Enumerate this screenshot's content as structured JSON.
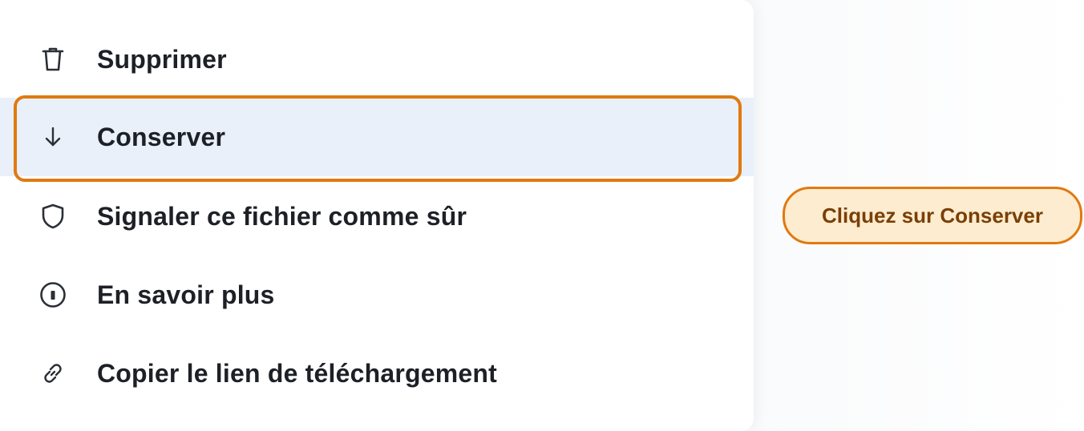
{
  "menu": {
    "items": [
      {
        "label": "Supprimer",
        "icon": "trash-icon"
      },
      {
        "label": "Conserver",
        "icon": "arrow-down-icon"
      },
      {
        "label": "Signaler ce fichier comme sûr",
        "icon": "shield-icon"
      },
      {
        "label": "En savoir plus",
        "icon": "info-icon"
      },
      {
        "label": "Copier le lien de téléchargement",
        "icon": "link-icon"
      }
    ],
    "highlighted_index": 1
  },
  "hint": {
    "text": "Cliquez sur Conserver"
  },
  "colors": {
    "accent": "#e07a10",
    "highlight_bg": "#e9f0fa",
    "hint_bg": "#fdeccf",
    "hint_text": "#7a3f06",
    "text": "#1d2026"
  }
}
